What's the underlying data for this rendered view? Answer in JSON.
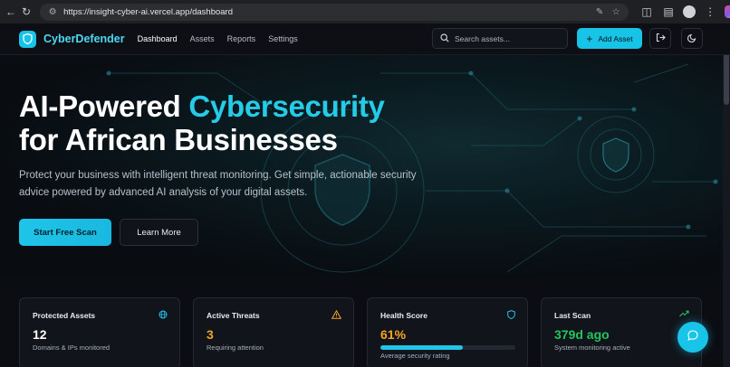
{
  "browser": {
    "url": "https://insight-cyber-ai.vercel.app/dashboard"
  },
  "app": {
    "brand": "CyberDefender",
    "nav": [
      {
        "label": "Dashboard",
        "active": true
      },
      {
        "label": "Assets",
        "active": false
      },
      {
        "label": "Reports",
        "active": false
      },
      {
        "label": "Settings",
        "active": false
      }
    ],
    "search_placeholder": "Search assets...",
    "add_asset_label": "Add Asset",
    "accent_color": "#17c3e6"
  },
  "hero": {
    "title_part1": "AI-Powered ",
    "title_accent": "Cybersecurity",
    "title_line2": "for African Businesses",
    "description": "Protect your business with intelligent threat monitoring. Get simple, actionable security advice powered by advanced AI analysis of your digital assets.",
    "primary_button": "Start Free Scan",
    "secondary_button": "Learn More"
  },
  "stats": [
    {
      "title": "Protected Assets",
      "value": "12",
      "subtitle": "Domains & IPs monitored",
      "icon": "globe-icon",
      "value_color": "#ffffff",
      "icon_color": "#20c6e8"
    },
    {
      "title": "Active Threats",
      "value": "3",
      "subtitle": "Requiring attention",
      "icon": "warning-icon",
      "value_color": "#f5a524",
      "icon_color": "#f5a524"
    },
    {
      "title": "Health Score",
      "value": "61%",
      "subtitle": "Average security rating",
      "icon": "shield-icon",
      "value_color": "#f5a524",
      "icon_color": "#20c6e8",
      "progress": 0.61
    },
    {
      "title": "Last Scan",
      "value": "379d ago",
      "subtitle": "System monitoring active",
      "icon": "trending-up-icon",
      "value_color": "#22c55e",
      "icon_color": "#22c55e"
    }
  ]
}
